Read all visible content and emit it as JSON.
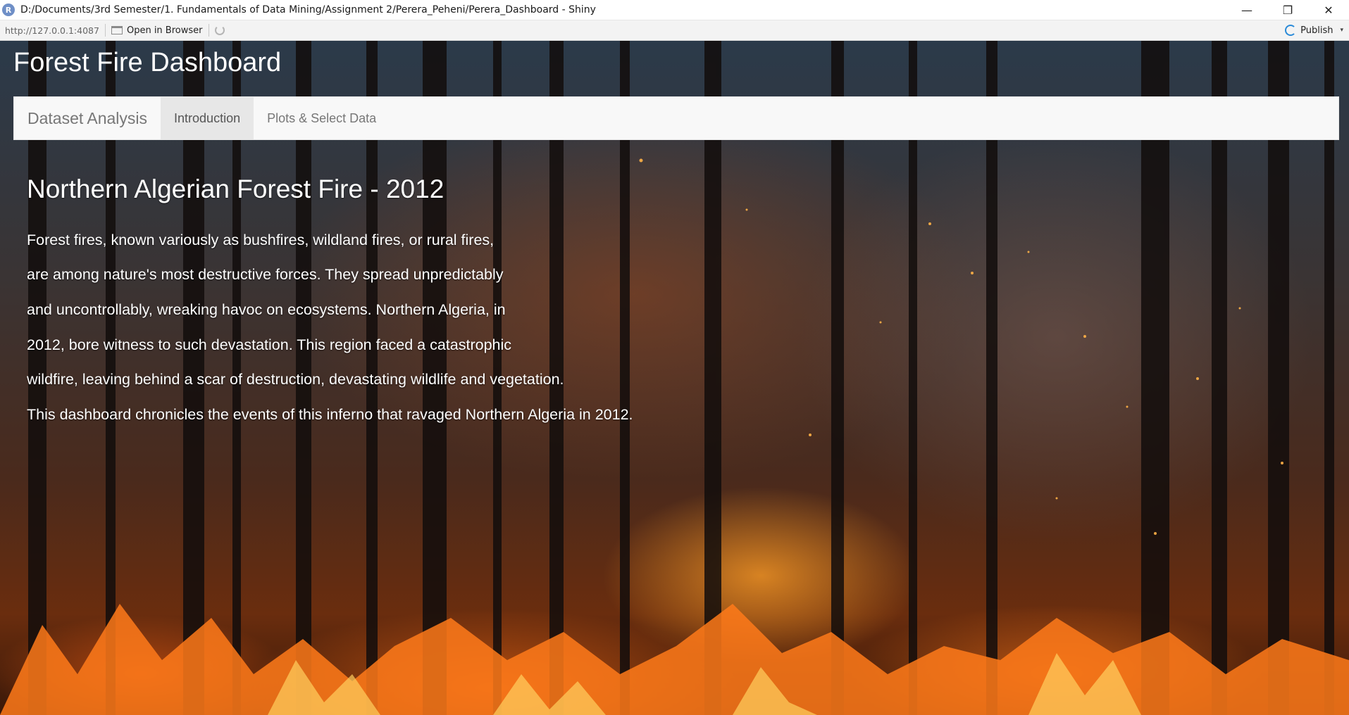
{
  "window": {
    "app_icon_letter": "R",
    "title": "D:/Documents/3rd Semester/1. Fundamentals of Data Mining/Assignment 2/Perera_Peheni/Perera_Dashboard - Shiny",
    "minimize": "—",
    "restore": "❐",
    "close": "✕"
  },
  "toolbar": {
    "url": "http://127.0.0.1:4087",
    "open_in_browser": "Open in Browser",
    "publish": "Publish",
    "publish_caret": "▾"
  },
  "app": {
    "title": "Forest Fire Dashboard",
    "navbar": {
      "brand": "Dataset Analysis",
      "tabs": [
        {
          "label": "Introduction",
          "active": true
        },
        {
          "label": "Plots & Select Data",
          "active": false
        }
      ]
    },
    "intro": {
      "heading": "Northern Algerian Forest Fire - 2012",
      "paragraph_lines": [
        "Forest fires, known variously as bushfires, wildland fires, or rural fires,",
        "are among nature's most destructive forces. They spread unpredictably",
        "and uncontrollably, wreaking havoc on ecosystems. Northern Algeria, in",
        "2012, bore witness to such devastation. This region faced a catastrophic",
        "wildfire, leaving behind a scar of destruction, devastating wildlife and vegetation.",
        "This dashboard chronicles the events of this inferno that ravaged Northern Algeria in 2012."
      ]
    }
  },
  "colors": {
    "navbar_bg": "#f8f8f8",
    "active_tab_bg": "#e7e7e7",
    "nav_text": "#777777",
    "publish_accent": "#2a8ad8"
  }
}
